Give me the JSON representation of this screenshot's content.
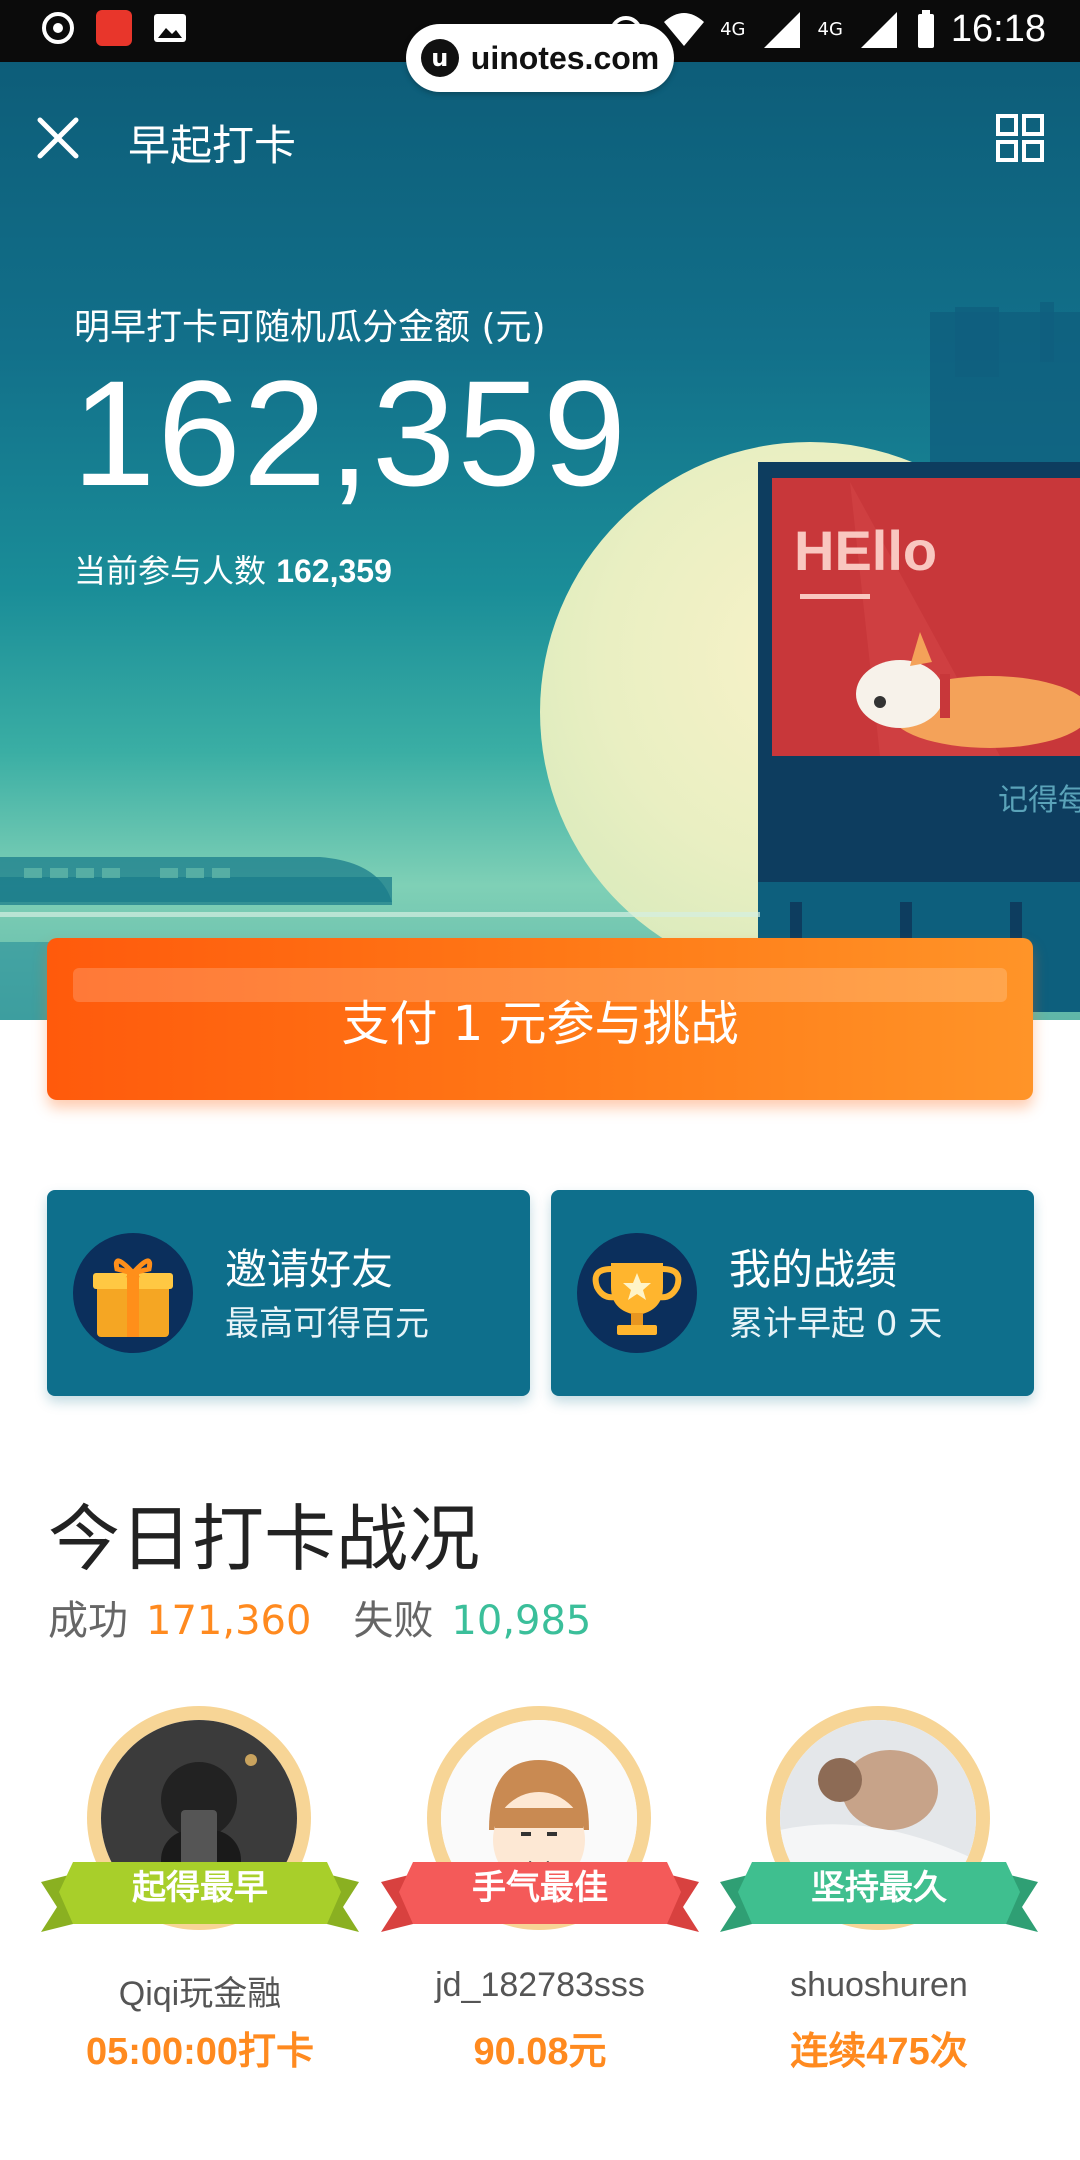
{
  "watermark": {
    "logo": "u",
    "text": "uinotes.com"
  },
  "status_bar": {
    "time": "16:18",
    "network_1": "4G",
    "network_2": "4G"
  },
  "nav": {
    "title": "早起打卡",
    "close_icon": "close-icon",
    "menu_icon": "grid-icon"
  },
  "hero": {
    "amount_label": "明早打卡可随机瓜分金额 (元)",
    "amount": "162,359",
    "participants_label": "当前参与人数",
    "participants_value": "162,359",
    "billboard_text": "HEllo",
    "billboard_sub": "记得每"
  },
  "cta": {
    "label": "支付 1 元参与挑战"
  },
  "cards": [
    {
      "title": "邀请好友",
      "subtitle": "最高可得百元",
      "icon": "gift-icon"
    },
    {
      "title": "我的战绩",
      "subtitle": "累计早起 0 天",
      "icon": "trophy-icon"
    }
  ],
  "today": {
    "title": "今日打卡战况",
    "success_label": "成功",
    "success_value": "171,360",
    "fail_label": "失败",
    "fail_value": "10,985"
  },
  "winners": [
    {
      "badge": "起得最早",
      "name": "Qiqi玩金融",
      "stat": "05:00:00打卡",
      "color": "#a8cf2a"
    },
    {
      "badge": "手气最佳",
      "name": "jd_182783sss",
      "stat": "90.08元",
      "color": "#f45a59"
    },
    {
      "badge": "坚持最久",
      "name": "shuoshuren",
      "stat": "连续475次",
      "color": "#3fbf8f"
    }
  ],
  "colors": {
    "accent": "#ff7a17",
    "card_bg": "#0e6f8c",
    "success": "#ff8a1f",
    "fail": "#3bbf9a"
  }
}
